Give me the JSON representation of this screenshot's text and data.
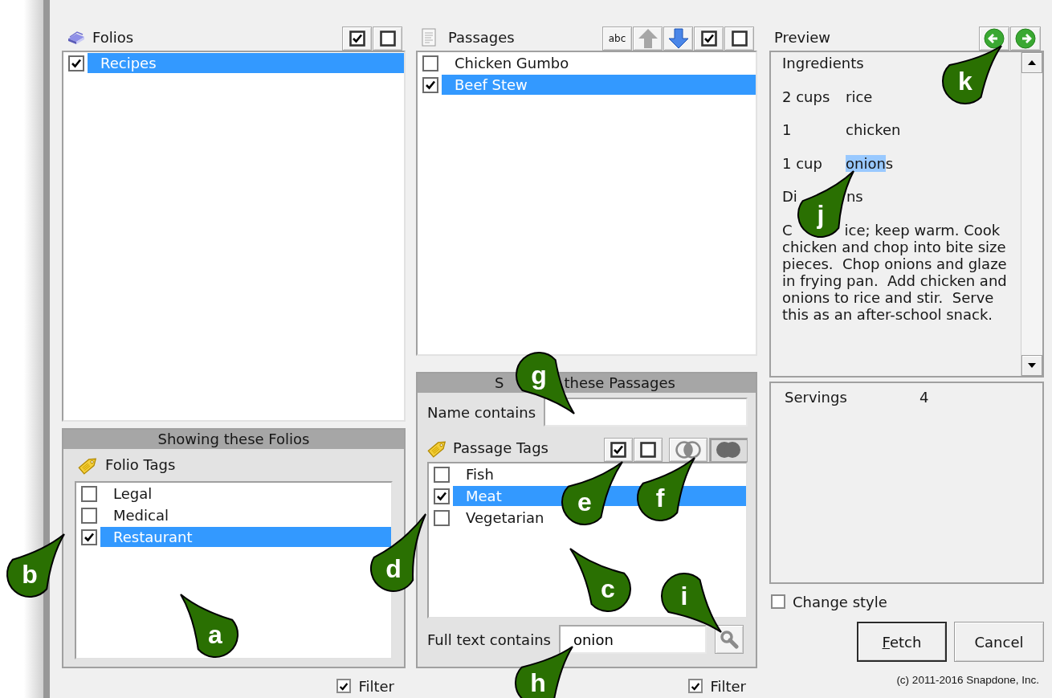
{
  "folios": {
    "title": "Folios",
    "toolbar": [
      {
        "kind": "check-all"
      },
      {
        "kind": "uncheck-all"
      }
    ],
    "items": [
      {
        "label": "Recipes",
        "checked": true,
        "selected": true
      }
    ]
  },
  "folio_filter": {
    "title": "Showing these Folios",
    "tags_label": "Folio Tags",
    "tags": [
      {
        "label": "Legal",
        "checked": false,
        "selected": false
      },
      {
        "label": "Medical",
        "checked": false,
        "selected": false
      },
      {
        "label": "Restaurant",
        "checked": true,
        "selected": true
      }
    ],
    "filter": {
      "label": "Filter",
      "checked": true
    }
  },
  "passages": {
    "title": "Passages",
    "toolbar": [
      {
        "kind": "text",
        "label": "abc",
        "disabled": false
      },
      {
        "kind": "up",
        "disabled": true
      },
      {
        "kind": "down",
        "disabled": false
      },
      {
        "kind": "check-all"
      },
      {
        "kind": "uncheck-all"
      }
    ],
    "items": [
      {
        "label": "Chicken Gumbo",
        "checked": false,
        "selected": false
      },
      {
        "label": "Beef Stew",
        "checked": true,
        "selected": true
      }
    ]
  },
  "passage_filter": {
    "title_parts": [
      "S",
      "these Passages"
    ],
    "name_label": "Name contains",
    "tags_label": "Passage Tags",
    "tag_toolbar": [
      {
        "kind": "check-all"
      },
      {
        "kind": "uncheck-all"
      },
      {
        "kind": "match-any",
        "pressed": false
      },
      {
        "kind": "match-all",
        "pressed": true
      }
    ],
    "tags": [
      {
        "label": "Fish",
        "checked": false,
        "selected": false
      },
      {
        "label": "Meat",
        "checked": true,
        "selected": true
      },
      {
        "label": "Vegetarian",
        "checked": false,
        "selected": false
      }
    ],
    "fulltext_label": "Full text contains",
    "fulltext_value": "onion",
    "filter": {
      "label": "Filter",
      "checked": true
    }
  },
  "preview": {
    "title": "Preview",
    "nav": [
      {
        "kind": "back"
      },
      {
        "kind": "forward"
      }
    ],
    "ingredients_heading": "Ingredients",
    "ingredients": [
      {
        "qty": "2 cups",
        "item_parts": [
          {
            "text": "rice",
            "highlighted": false
          }
        ]
      },
      {
        "qty": "1",
        "item_parts": [
          {
            "text": "chicken",
            "highlighted": false
          }
        ]
      },
      {
        "qty": "1 cup",
        "item_parts": [
          {
            "text": "onion",
            "highlighted": true
          },
          {
            "text": "s",
            "highlighted": false
          }
        ]
      }
    ],
    "directions_heading_parts": [
      "Di",
      "ns"
    ],
    "directions_first_line_parts": [
      "C",
      "ice; keep warm. Cook"
    ],
    "directions_lines": [
      "chicken and chop into bite size",
      "pieces.  Chop onions and glaze",
      "in frying pan.  Add chicken and",
      "onions to rice and stir.  Serve",
      "this as an after-school snack."
    ]
  },
  "fields": [
    {
      "label": "Servings",
      "value": "4"
    }
  ],
  "change_style": {
    "label": "Change style",
    "checked": false
  },
  "buttons": [
    {
      "label": "Fetch",
      "default": true,
      "mnemonic_first_letter": true
    },
    {
      "label": "Cancel",
      "default": false,
      "mnemonic_first_letter": false
    }
  ],
  "copyright": "(c) 2011-2016 Snapdone, Inc.",
  "callouts": [
    {
      "label": "a"
    },
    {
      "label": "b"
    },
    {
      "label": "c"
    },
    {
      "label": "d"
    },
    {
      "label": "e"
    },
    {
      "label": "f"
    },
    {
      "label": "g"
    },
    {
      "label": "h"
    },
    {
      "label": "i"
    },
    {
      "label": "j"
    },
    {
      "label": "k"
    }
  ]
}
